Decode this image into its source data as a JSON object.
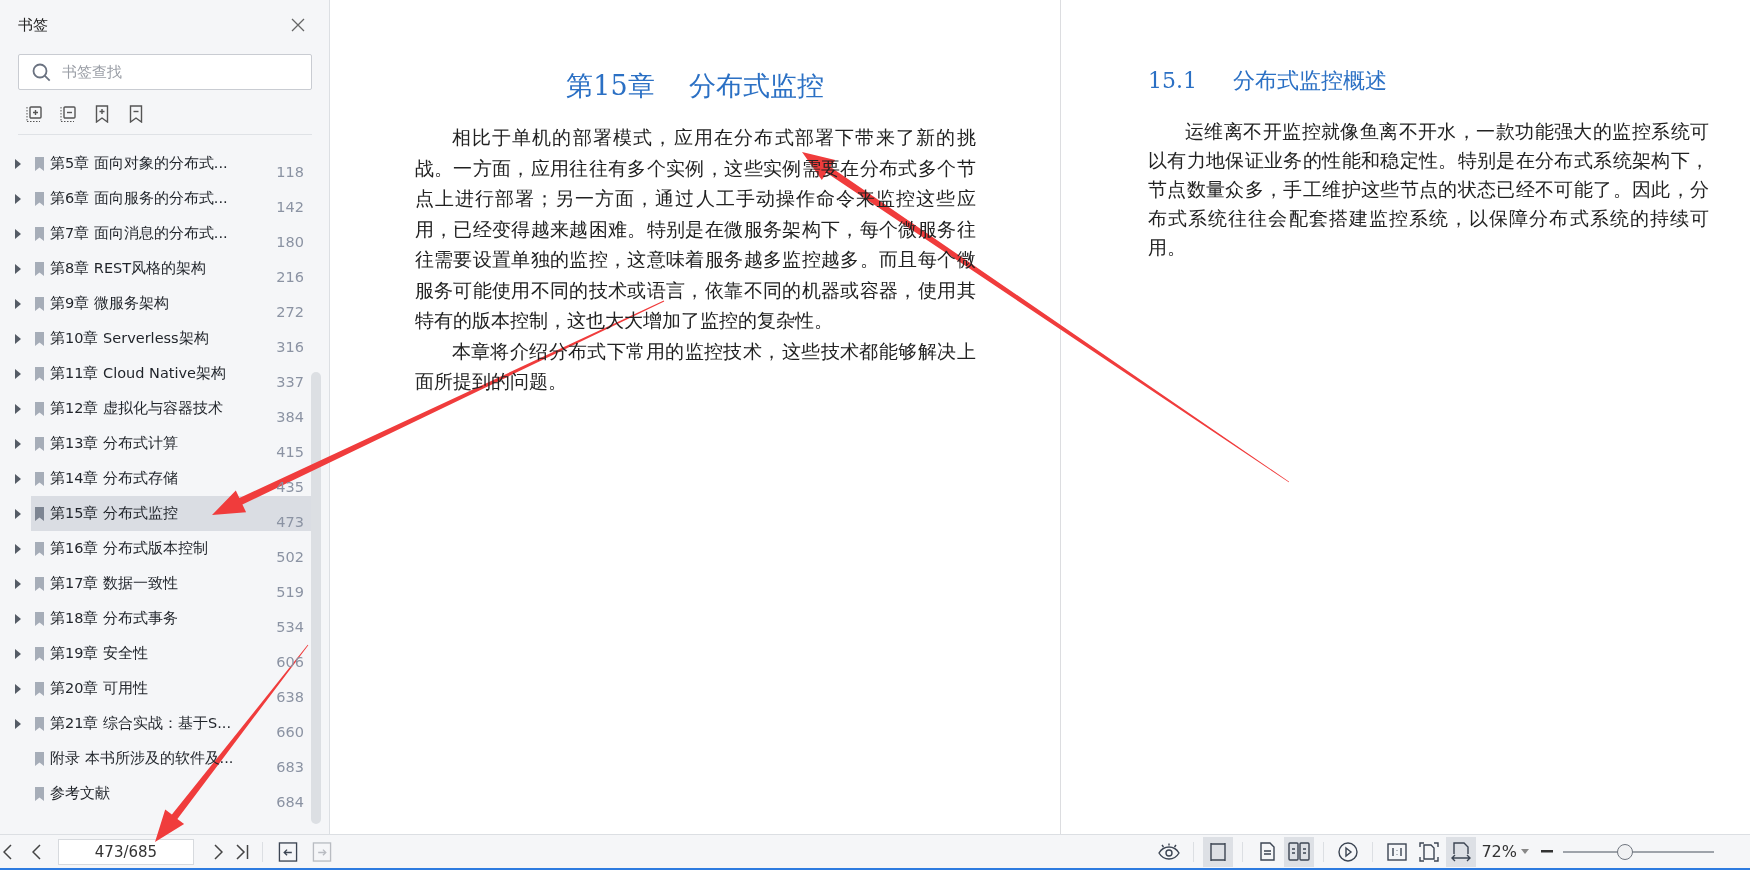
{
  "sidebar": {
    "title": "书签",
    "search": {
      "placeholder": "书签查找"
    },
    "tools": [
      {
        "kind": "expand"
      },
      {
        "kind": "collapse"
      },
      {
        "kind": "add"
      },
      {
        "kind": "remove"
      }
    ],
    "items": [
      {
        "label": "第5章 面向对象的分布式...",
        "page": "118",
        "expandable": true,
        "selected": false
      },
      {
        "label": "第6章 面向服务的分布式...",
        "page": "142",
        "expandable": true,
        "selected": false
      },
      {
        "label": "第7章 面向消息的分布式...",
        "page": "180",
        "expandable": true,
        "selected": false
      },
      {
        "label": "第8章 REST风格的架构",
        "page": "216",
        "expandable": true,
        "selected": false
      },
      {
        "label": "第9章 微服务架构",
        "page": "272",
        "expandable": true,
        "selected": false
      },
      {
        "label": "第10章 Serverless架构",
        "page": "316",
        "expandable": true,
        "selected": false
      },
      {
        "label": "第11章 Cloud Native架构",
        "page": "337",
        "expandable": true,
        "selected": false
      },
      {
        "label": "第12章 虚拟化与容器技术",
        "page": "384",
        "expandable": true,
        "selected": false
      },
      {
        "label": "第13章 分布式计算",
        "page": "415",
        "expandable": true,
        "selected": false
      },
      {
        "label": "第14章 分布式存储",
        "page": "435",
        "expandable": true,
        "selected": false
      },
      {
        "label": "第15章 分布式监控",
        "page": "473",
        "expandable": true,
        "selected": true
      },
      {
        "label": "第16章 分布式版本控制",
        "page": "502",
        "expandable": true,
        "selected": false
      },
      {
        "label": "第17章 数据一致性",
        "page": "519",
        "expandable": true,
        "selected": false
      },
      {
        "label": "第18章 分布式事务",
        "page": "534",
        "expandable": true,
        "selected": false
      },
      {
        "label": "第19章 安全性",
        "page": "606",
        "expandable": true,
        "selected": false
      },
      {
        "label": "第20章 可用性",
        "page": "638",
        "expandable": true,
        "selected": false
      },
      {
        "label": "第21章 综合实战：基于S...",
        "page": "660",
        "expandable": true,
        "selected": false
      },
      {
        "label": "附录 本书所涉及的软件及...",
        "page": "683",
        "expandable": false,
        "selected": false
      },
      {
        "label": "参考文献",
        "page": "684",
        "expandable": false,
        "selected": false
      }
    ]
  },
  "document": {
    "left_page": {
      "chapter_number": "第15章",
      "chapter_title": "分布式监控",
      "paragraphs": [
        "相比于单机的部署模式，应用在分布式部署下带来了新的挑战。一方面，应用往往有多个实例，这些实例需要在分布式多个节点上进行部署；另一方面，通过人工手动操作命令来监控这些应用，已经变得越来越困难。特别是在微服务架构下，每个微服务往往需要设置单独的监控，这意味着服务越多监控越多。而且每个微服务可能使用不同的技术或语言，依靠不同的机器或容器，使用其特有的版本控制，这也大大增加了监控的复杂性。",
        "本章将介绍分布式下常用的监控技术，这些技术都能够解决上面所提到的问题。"
      ]
    },
    "right_page": {
      "section_number": "15.1",
      "section_title": "分布式监控概述",
      "paragraphs": [
        "运维离不开监控就像鱼离不开水，一款功能强大的监控系统可以有力地保证业务的性能和稳定性。特别是在分布式系统架构下，节点数量众多，手工维护这些节点的状态已经不可能了。因此，分布式系统往往会配套搭建监控系统，以保障分布式系统的持续可用。"
      ]
    }
  },
  "annotations": [
    {
      "kind": "arrow"
    },
    {
      "kind": "arrow"
    },
    {
      "kind": "arrow"
    }
  ],
  "status_bar": {
    "nav": [
      {
        "kind": "first"
      },
      {
        "kind": "prev"
      }
    ],
    "page_field": "473/685",
    "nav_after": [
      {
        "kind": "next"
      },
      {
        "kind": "last"
      }
    ],
    "history": [
      {
        "kind": "back",
        "disabled": false
      },
      {
        "kind": "forward",
        "disabled": true
      }
    ],
    "view_tools": [
      {
        "kind": "eye",
        "selected": false
      },
      {
        "kind": "continuous",
        "selected": true
      },
      {
        "kind": "single",
        "selected": false
      },
      {
        "kind": "double",
        "selected": true
      },
      {
        "kind": "play",
        "selected": false
      },
      {
        "kind": "actual",
        "selected": false
      },
      {
        "kind": "fitpage",
        "selected": false
      },
      {
        "kind": "fitwidth",
        "selected": true
      }
    ],
    "zoom": {
      "value": "72%",
      "level": 0.41
    }
  }
}
